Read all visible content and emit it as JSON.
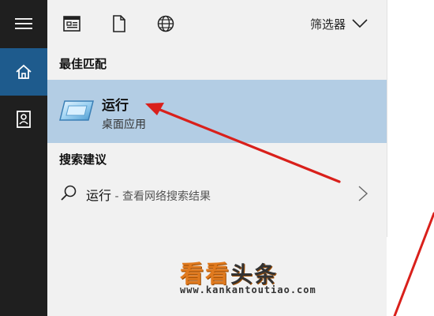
{
  "rail": {
    "items": [
      {
        "icon": "hamburger-menu-icon"
      },
      {
        "icon": "home-icon",
        "selected": true
      },
      {
        "icon": "documents-icon"
      }
    ]
  },
  "topbar": {
    "icons": [
      "apps-icon",
      "document-icon",
      "web-globe-icon"
    ],
    "filter_label": "筛选器"
  },
  "best_match": {
    "section_title": "最佳匹配",
    "name": "运行",
    "subtitle": "桌面应用",
    "icon": "run-app-icon"
  },
  "suggestions": {
    "section_title": "搜索建议",
    "items": [
      {
        "text": "运行",
        "desc": " - 查看网络搜索结果",
        "icon": "search-icon"
      }
    ]
  },
  "watermark": {
    "brand_a": "看看",
    "brand_b": "头条",
    "url": "www.kankantoutiao.com"
  },
  "colors": {
    "rail_bg": "#1f1f1f",
    "rail_selected": "#1e5b8d",
    "panel_bg": "#f1f1f1",
    "highlight": "#b3cde4",
    "arrow": "#d9201b",
    "watermark_orange": "#e07a1f"
  }
}
